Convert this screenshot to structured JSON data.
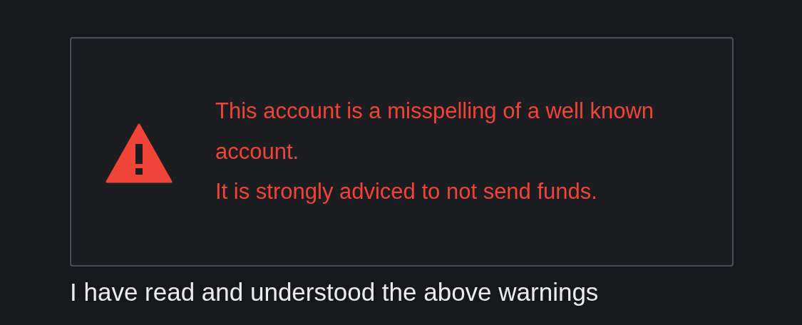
{
  "warning": {
    "messages": [
      "This account is a misspelling of a well known account.",
      "It is strongly adviced to not send funds."
    ]
  },
  "confirmation": {
    "label": "I have read and understood the above warnings"
  }
}
